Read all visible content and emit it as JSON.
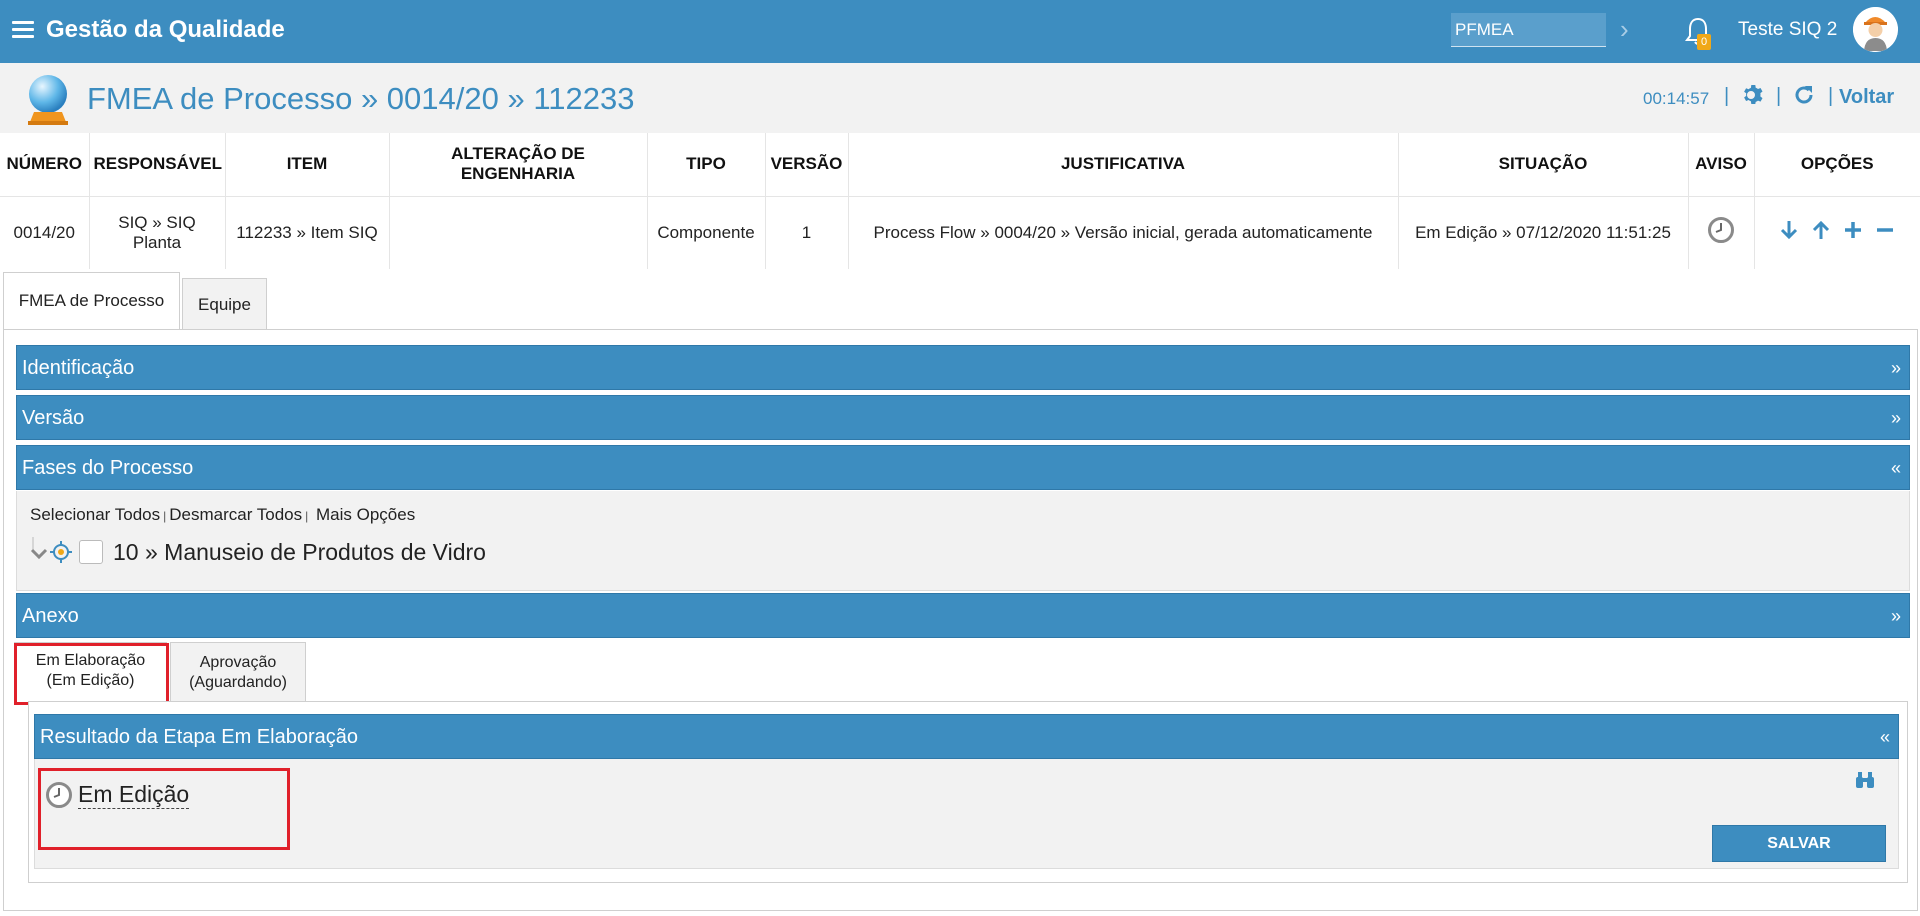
{
  "app": {
    "title": "Gestão da Qualidade"
  },
  "search": {
    "value": "PFMEA"
  },
  "notifications": {
    "count": "0"
  },
  "user": {
    "name": "Teste SIQ 2"
  },
  "header": {
    "title": "FMEA de Processo » 0014/20 » 112233",
    "timer": "00:14:57",
    "back_label": "Voltar",
    "separator": "|"
  },
  "table": {
    "columns": [
      "NÚMERO",
      "RESPONSÁVEL",
      "ITEM",
      "ALTERAÇÃO DE ENGENHARIA",
      "TIPO",
      "VERSÃO",
      "JUSTIFICATIVA",
      "SITUAÇÃO",
      "AVISO",
      "OPÇÕES"
    ],
    "row": {
      "numero": "0014/20",
      "responsavel": "SIQ » SIQ Planta",
      "item": "112233 » Item SIQ",
      "alteracao": "",
      "tipo": "Componente",
      "versao": "1",
      "justificativa": "Process Flow » 0004/20 » Versão inicial, gerada automaticamente",
      "situacao": "Em Edição » 07/12/2020 11:51:25"
    }
  },
  "tabs": [
    {
      "label": "FMEA de Processo",
      "active": true
    },
    {
      "label": "Equipe",
      "active": false
    }
  ],
  "panels": {
    "identificacao": "Identificação",
    "versao": "Versão",
    "fases": "Fases do Processo",
    "anexo": "Anexo",
    "expand": "»",
    "collapse": "«"
  },
  "fases": {
    "select_all": "Selecionar Todos",
    "deselect_all": "Desmarcar Todos",
    "more_options": "Mais Opções",
    "pipe": "|",
    "items": [
      {
        "label": "10 » Manuseio de Produtos de Vidro"
      }
    ]
  },
  "workflow_tabs": [
    {
      "line1": "Em Elaboração",
      "line2": "(Em Edição)",
      "active": true
    },
    {
      "line1": "Aprovação",
      "line2": "(Aguardando)",
      "active": false
    }
  ],
  "result": {
    "title": "Resultado da Etapa Em Elaboração",
    "status": "Em Edição",
    "save_label": "SALVAR"
  },
  "colors": {
    "primary": "#3d8dc0",
    "highlight": "#e0202a",
    "badge": "#f0a818"
  }
}
